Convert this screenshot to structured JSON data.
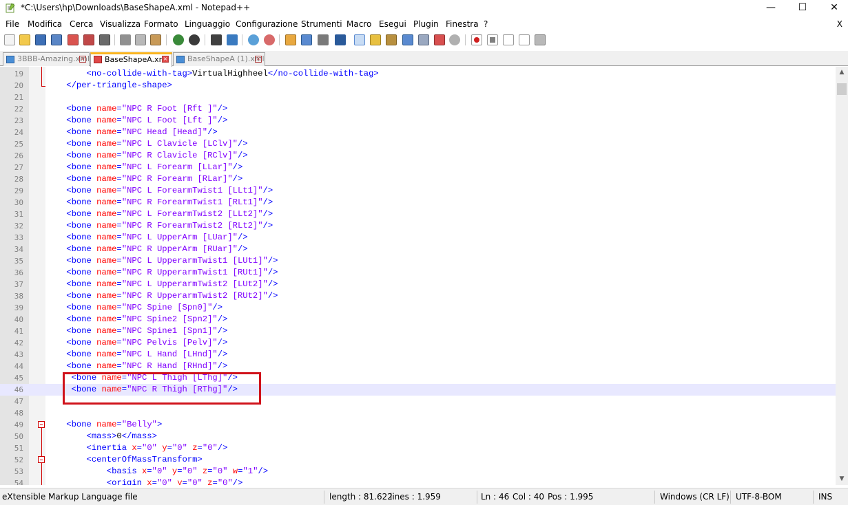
{
  "window": {
    "title": "*C:\\Users\\hp\\Downloads\\BaseShapeA.xml - Notepad++",
    "minimize": "—",
    "maximize": "☐",
    "close": "✕"
  },
  "menu": {
    "items": [
      "File",
      "Modifica",
      "Cerca",
      "Visualizza",
      "Formato",
      "Linguaggio",
      "Configurazione",
      "Strumenti",
      "Macro",
      "Esegui",
      "Plugin",
      "Finestra",
      "?"
    ],
    "close": "X"
  },
  "tabs": [
    {
      "label": "3BBB-Amazing.xml",
      "active": false
    },
    {
      "label": "BaseShapeA.xml",
      "active": true
    },
    {
      "label": "BaseShapeA (1).xml",
      "active": false
    }
  ],
  "editor": {
    "current_line": 46,
    "lines": [
      {
        "n": "19",
        "tokens": [
          [
            "i",
            "        "
          ],
          [
            "tag",
            "<no-collide-with-tag>"
          ],
          [
            "text",
            "VirtualHighheel"
          ],
          [
            "tag",
            "</no-collide-with-tag>"
          ]
        ]
      },
      {
        "n": "20",
        "tokens": [
          [
            "i",
            "    "
          ],
          [
            "tag",
            "</per-triangle-shape>"
          ]
        ]
      },
      {
        "n": "21",
        "tokens": []
      },
      {
        "n": "22",
        "tokens": [
          [
            "i",
            "    "
          ],
          [
            "tag",
            "<bone "
          ],
          [
            "attr",
            "name"
          ],
          [
            "tag",
            "="
          ],
          [
            "val",
            "\"NPC R Foot [Rft ]\""
          ],
          [
            "tag",
            "/>"
          ]
        ]
      },
      {
        "n": "23",
        "tokens": [
          [
            "i",
            "    "
          ],
          [
            "tag",
            "<bone "
          ],
          [
            "attr",
            "name"
          ],
          [
            "tag",
            "="
          ],
          [
            "val",
            "\"NPC L Foot [Lft ]\""
          ],
          [
            "tag",
            "/>"
          ]
        ]
      },
      {
        "n": "24",
        "tokens": [
          [
            "i",
            "    "
          ],
          [
            "tag",
            "<bone "
          ],
          [
            "attr",
            "name"
          ],
          [
            "tag",
            "="
          ],
          [
            "val",
            "\"NPC Head [Head]\""
          ],
          [
            "tag",
            "/>"
          ]
        ]
      },
      {
        "n": "25",
        "tokens": [
          [
            "i",
            "    "
          ],
          [
            "tag",
            "<bone "
          ],
          [
            "attr",
            "name"
          ],
          [
            "tag",
            "="
          ],
          [
            "val",
            "\"NPC L Clavicle [LClv]\""
          ],
          [
            "tag",
            "/>"
          ]
        ]
      },
      {
        "n": "26",
        "tokens": [
          [
            "i",
            "    "
          ],
          [
            "tag",
            "<bone "
          ],
          [
            "attr",
            "name"
          ],
          [
            "tag",
            "="
          ],
          [
            "val",
            "\"NPC R Clavicle [RClv]\""
          ],
          [
            "tag",
            "/>"
          ]
        ]
      },
      {
        "n": "27",
        "tokens": [
          [
            "i",
            "    "
          ],
          [
            "tag",
            "<bone "
          ],
          [
            "attr",
            "name"
          ],
          [
            "tag",
            "="
          ],
          [
            "val",
            "\"NPC L Forearm [LLar]\""
          ],
          [
            "tag",
            "/>"
          ]
        ]
      },
      {
        "n": "28",
        "tokens": [
          [
            "i",
            "    "
          ],
          [
            "tag",
            "<bone "
          ],
          [
            "attr",
            "name"
          ],
          [
            "tag",
            "="
          ],
          [
            "val",
            "\"NPC R Forearm [RLar]\""
          ],
          [
            "tag",
            "/>"
          ]
        ]
      },
      {
        "n": "29",
        "tokens": [
          [
            "i",
            "    "
          ],
          [
            "tag",
            "<bone "
          ],
          [
            "attr",
            "name"
          ],
          [
            "tag",
            "="
          ],
          [
            "val",
            "\"NPC L ForearmTwist1 [LLt1]\""
          ],
          [
            "tag",
            "/>"
          ]
        ]
      },
      {
        "n": "30",
        "tokens": [
          [
            "i",
            "    "
          ],
          [
            "tag",
            "<bone "
          ],
          [
            "attr",
            "name"
          ],
          [
            "tag",
            "="
          ],
          [
            "val",
            "\"NPC R ForearmTwist1 [RLt1]\""
          ],
          [
            "tag",
            "/>"
          ]
        ]
      },
      {
        "n": "31",
        "tokens": [
          [
            "i",
            "    "
          ],
          [
            "tag",
            "<bone "
          ],
          [
            "attr",
            "name"
          ],
          [
            "tag",
            "="
          ],
          [
            "val",
            "\"NPC L ForearmTwist2 [LLt2]\""
          ],
          [
            "tag",
            "/>"
          ]
        ]
      },
      {
        "n": "32",
        "tokens": [
          [
            "i",
            "    "
          ],
          [
            "tag",
            "<bone "
          ],
          [
            "attr",
            "name"
          ],
          [
            "tag",
            "="
          ],
          [
            "val",
            "\"NPC R ForearmTwist2 [RLt2]\""
          ],
          [
            "tag",
            "/>"
          ]
        ]
      },
      {
        "n": "33",
        "tokens": [
          [
            "i",
            "    "
          ],
          [
            "tag",
            "<bone "
          ],
          [
            "attr",
            "name"
          ],
          [
            "tag",
            "="
          ],
          [
            "val",
            "\"NPC L UpperArm [LUar]\""
          ],
          [
            "tag",
            "/>"
          ]
        ]
      },
      {
        "n": "34",
        "tokens": [
          [
            "i",
            "    "
          ],
          [
            "tag",
            "<bone "
          ],
          [
            "attr",
            "name"
          ],
          [
            "tag",
            "="
          ],
          [
            "val",
            "\"NPC R UpperArm [RUar]\""
          ],
          [
            "tag",
            "/>"
          ]
        ]
      },
      {
        "n": "35",
        "tokens": [
          [
            "i",
            "    "
          ],
          [
            "tag",
            "<bone "
          ],
          [
            "attr",
            "name"
          ],
          [
            "tag",
            "="
          ],
          [
            "val",
            "\"NPC L UpperarmTwist1 [LUt1]\""
          ],
          [
            "tag",
            "/>"
          ]
        ]
      },
      {
        "n": "36",
        "tokens": [
          [
            "i",
            "    "
          ],
          [
            "tag",
            "<bone "
          ],
          [
            "attr",
            "name"
          ],
          [
            "tag",
            "="
          ],
          [
            "val",
            "\"NPC R UpperarmTwist1 [RUt1]\""
          ],
          [
            "tag",
            "/>"
          ]
        ]
      },
      {
        "n": "37",
        "tokens": [
          [
            "i",
            "    "
          ],
          [
            "tag",
            "<bone "
          ],
          [
            "attr",
            "name"
          ],
          [
            "tag",
            "="
          ],
          [
            "val",
            "\"NPC L UpperarmTwist2 [LUt2]\""
          ],
          [
            "tag",
            "/>"
          ]
        ]
      },
      {
        "n": "38",
        "tokens": [
          [
            "i",
            "    "
          ],
          [
            "tag",
            "<bone "
          ],
          [
            "attr",
            "name"
          ],
          [
            "tag",
            "="
          ],
          [
            "val",
            "\"NPC R UpperarmTwist2 [RUt2]\""
          ],
          [
            "tag",
            "/>"
          ]
        ]
      },
      {
        "n": "39",
        "tokens": [
          [
            "i",
            "    "
          ],
          [
            "tag",
            "<bone "
          ],
          [
            "attr",
            "name"
          ],
          [
            "tag",
            "="
          ],
          [
            "val",
            "\"NPC Spine [Spn0]\""
          ],
          [
            "tag",
            "/>"
          ]
        ]
      },
      {
        "n": "40",
        "tokens": [
          [
            "i",
            "    "
          ],
          [
            "tag",
            "<bone "
          ],
          [
            "attr",
            "name"
          ],
          [
            "tag",
            "="
          ],
          [
            "val",
            "\"NPC Spine2 [Spn2]\""
          ],
          [
            "tag",
            "/>"
          ]
        ]
      },
      {
        "n": "41",
        "tokens": [
          [
            "i",
            "    "
          ],
          [
            "tag",
            "<bone "
          ],
          [
            "attr",
            "name"
          ],
          [
            "tag",
            "="
          ],
          [
            "val",
            "\"NPC Spine1 [Spn1]\""
          ],
          [
            "tag",
            "/>"
          ]
        ]
      },
      {
        "n": "42",
        "tokens": [
          [
            "i",
            "    "
          ],
          [
            "tag",
            "<bone "
          ],
          [
            "attr",
            "name"
          ],
          [
            "tag",
            "="
          ],
          [
            "val",
            "\"NPC Pelvis [Pelv]\""
          ],
          [
            "tag",
            "/>"
          ]
        ]
      },
      {
        "n": "43",
        "tokens": [
          [
            "i",
            "    "
          ],
          [
            "tag",
            "<bone "
          ],
          [
            "attr",
            "name"
          ],
          [
            "tag",
            "="
          ],
          [
            "val",
            "\"NPC L Hand [LHnd]\""
          ],
          [
            "tag",
            "/>"
          ]
        ]
      },
      {
        "n": "44",
        "tokens": [
          [
            "i",
            "    "
          ],
          [
            "tag",
            "<bone "
          ],
          [
            "attr",
            "name"
          ],
          [
            "tag",
            "="
          ],
          [
            "val",
            "\"NPC R Hand [RHnd]\""
          ],
          [
            "tag",
            "/>"
          ]
        ]
      },
      {
        "n": "45",
        "tokens": [
          [
            "i",
            "     "
          ],
          [
            "tag",
            "<bone "
          ],
          [
            "attr",
            "name"
          ],
          [
            "tag",
            "="
          ],
          [
            "val",
            "\"NPC L Thigh [LThg]\""
          ],
          [
            "tag",
            "/>"
          ]
        ]
      },
      {
        "n": "46",
        "tokens": [
          [
            "i",
            "     "
          ],
          [
            "tag",
            "<bone "
          ],
          [
            "attr",
            "name"
          ],
          [
            "tag",
            "="
          ],
          [
            "val",
            "\"NPC R Thigh [RThg]\""
          ],
          [
            "tag",
            "/>"
          ]
        ]
      },
      {
        "n": "47",
        "tokens": []
      },
      {
        "n": "48",
        "tokens": []
      },
      {
        "n": "49",
        "tokens": [
          [
            "i",
            "    "
          ],
          [
            "tag",
            "<bone "
          ],
          [
            "attr",
            "name"
          ],
          [
            "tag",
            "="
          ],
          [
            "val",
            "\"Belly\""
          ],
          [
            "tag",
            ">"
          ]
        ]
      },
      {
        "n": "50",
        "tokens": [
          [
            "i",
            "        "
          ],
          [
            "tag",
            "<mass>"
          ],
          [
            "text",
            "0"
          ],
          [
            "tag",
            "</mass>"
          ]
        ]
      },
      {
        "n": "51",
        "tokens": [
          [
            "i",
            "        "
          ],
          [
            "tag",
            "<inertia "
          ],
          [
            "attr",
            "x"
          ],
          [
            "tag",
            "="
          ],
          [
            "val",
            "\"0\""
          ],
          [
            "tag",
            " "
          ],
          [
            "attr",
            "y"
          ],
          [
            "tag",
            "="
          ],
          [
            "val",
            "\"0\""
          ],
          [
            "tag",
            " "
          ],
          [
            "attr",
            "z"
          ],
          [
            "tag",
            "="
          ],
          [
            "val",
            "\"0\""
          ],
          [
            "tag",
            "/>"
          ]
        ]
      },
      {
        "n": "52",
        "tokens": [
          [
            "i",
            "        "
          ],
          [
            "tag",
            "<centerOfMassTransform>"
          ]
        ]
      },
      {
        "n": "53",
        "tokens": [
          [
            "i",
            "            "
          ],
          [
            "tag",
            "<basis "
          ],
          [
            "attr",
            "x"
          ],
          [
            "tag",
            "="
          ],
          [
            "val",
            "\"0\""
          ],
          [
            "tag",
            " "
          ],
          [
            "attr",
            "y"
          ],
          [
            "tag",
            "="
          ],
          [
            "val",
            "\"0\""
          ],
          [
            "tag",
            " "
          ],
          [
            "attr",
            "z"
          ],
          [
            "tag",
            "="
          ],
          [
            "val",
            "\"0\""
          ],
          [
            "tag",
            " "
          ],
          [
            "attr",
            "w"
          ],
          [
            "tag",
            "="
          ],
          [
            "val",
            "\"1\""
          ],
          [
            "tag",
            "/>"
          ]
        ]
      },
      {
        "n": "54",
        "tokens": [
          [
            "i",
            "            "
          ],
          [
            "tag",
            "<origin "
          ],
          [
            "attr",
            "x"
          ],
          [
            "tag",
            "="
          ],
          [
            "val",
            "\"0\""
          ],
          [
            "tag",
            " "
          ],
          [
            "attr",
            "y"
          ],
          [
            "tag",
            "="
          ],
          [
            "val",
            "\"0\""
          ],
          [
            "tag",
            " "
          ],
          [
            "attr",
            "z"
          ],
          [
            "tag",
            "="
          ],
          [
            "val",
            "\"0\""
          ],
          [
            "tag",
            "/>"
          ]
        ]
      }
    ]
  },
  "status": {
    "filetype": "eXtensible Markup Language file",
    "length": "length : 81.622",
    "lines": "lines : 1.959",
    "ln": "Ln : 46",
    "col": "Col : 40",
    "pos": "Pos : 1.995",
    "eol": "Windows (CR LF)",
    "encoding": "UTF-8-BOM",
    "mode": "INS"
  },
  "colors": {
    "tag": "#0000ff",
    "attr": "#ff0000",
    "value": "#8000ff",
    "highlight": "#d0121b",
    "current_line": "#e8e8ff"
  }
}
